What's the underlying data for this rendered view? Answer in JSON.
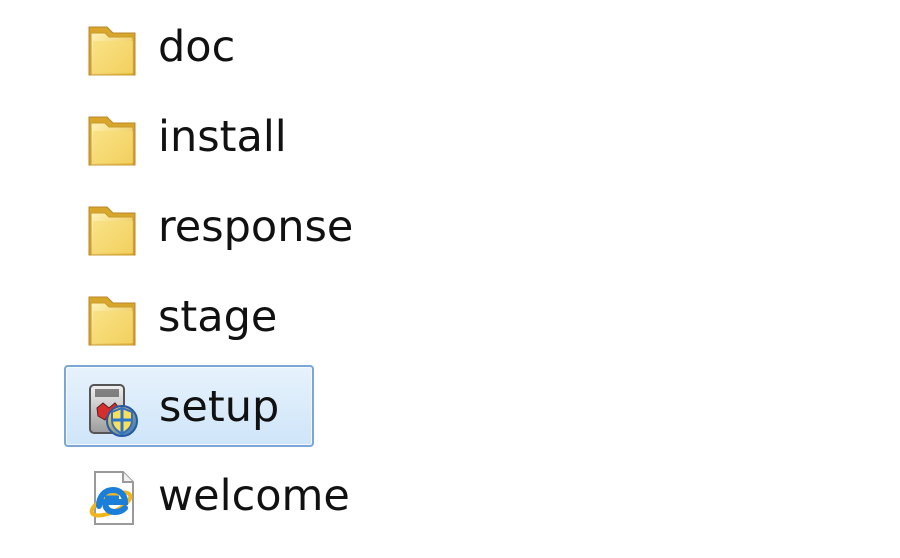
{
  "items": [
    {
      "label": "doc",
      "type": "folder",
      "icon": "folder-icon"
    },
    {
      "label": "install",
      "type": "folder",
      "icon": "folder-icon"
    },
    {
      "label": "response",
      "type": "folder",
      "icon": "folder-icon"
    },
    {
      "label": "stage",
      "type": "folder",
      "icon": "folder-icon"
    },
    {
      "label": "setup",
      "type": "application",
      "icon": "installer-shield-icon",
      "selected": true
    },
    {
      "label": "welcome",
      "type": "html-document",
      "icon": "internet-explorer-document-icon"
    }
  ],
  "colors": {
    "selection_fill": "#cfe5f9",
    "selection_border": "#7aa7d8",
    "folder_yellow": "#f2d36b",
    "ie_blue": "#1b7ed8"
  }
}
